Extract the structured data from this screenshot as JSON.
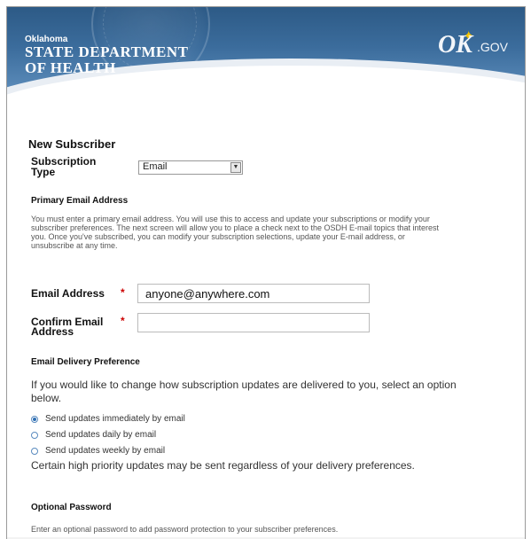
{
  "header": {
    "agency_small": "Oklahoma",
    "agency_line1": "State Department",
    "agency_line2": "of Health",
    "logo_ok": "OK",
    "logo_gov": ".GOV"
  },
  "form": {
    "title": "New Subscriber",
    "subscription_type_label_1": "Subscription",
    "subscription_type_label_2": "Type",
    "subscription_type_value": "Email",
    "primary_email_heading": "Primary Email Address",
    "primary_email_help_1": "You must enter a primary email address. You will use this to access and update your subscriptions or modify your",
    "primary_email_help_2": "subscriber preferences.  The next screen will allow you to place a check next to the OSDH E-mail topics that interest",
    "primary_email_help_3": "you. Once you've subscribed, you can modify your subscription selections, update your E-mail address, or",
    "primary_email_help_4": "unsubscribe at any time.",
    "email_label": "Email Address",
    "email_value": "anyone@anywhere.com",
    "confirm_label_1": "Confirm Email",
    "confirm_label_2": "Address",
    "confirm_value": "",
    "required_marker": "*",
    "delivery_heading": "Email Delivery Preference",
    "delivery_intro_1": "If you would like to change how subscription updates are delivered to you, select an option",
    "delivery_intro_2": "below.",
    "delivery_options": [
      {
        "label": "Send updates immediately by email",
        "selected": true
      },
      {
        "label": "Send updates daily by email",
        "selected": false
      },
      {
        "label": "Send updates weekly by email",
        "selected": false
      }
    ],
    "delivery_note": "Certain high priority updates may be sent regardless of your delivery preferences.",
    "password_heading": "Optional Password",
    "password_help": "Enter an optional password to add password protection to your subscriber preferences."
  },
  "colors": {
    "banner_blue": "#3b6c9c",
    "required_red": "#cc0000",
    "radio_blue": "#2f6fb4"
  }
}
